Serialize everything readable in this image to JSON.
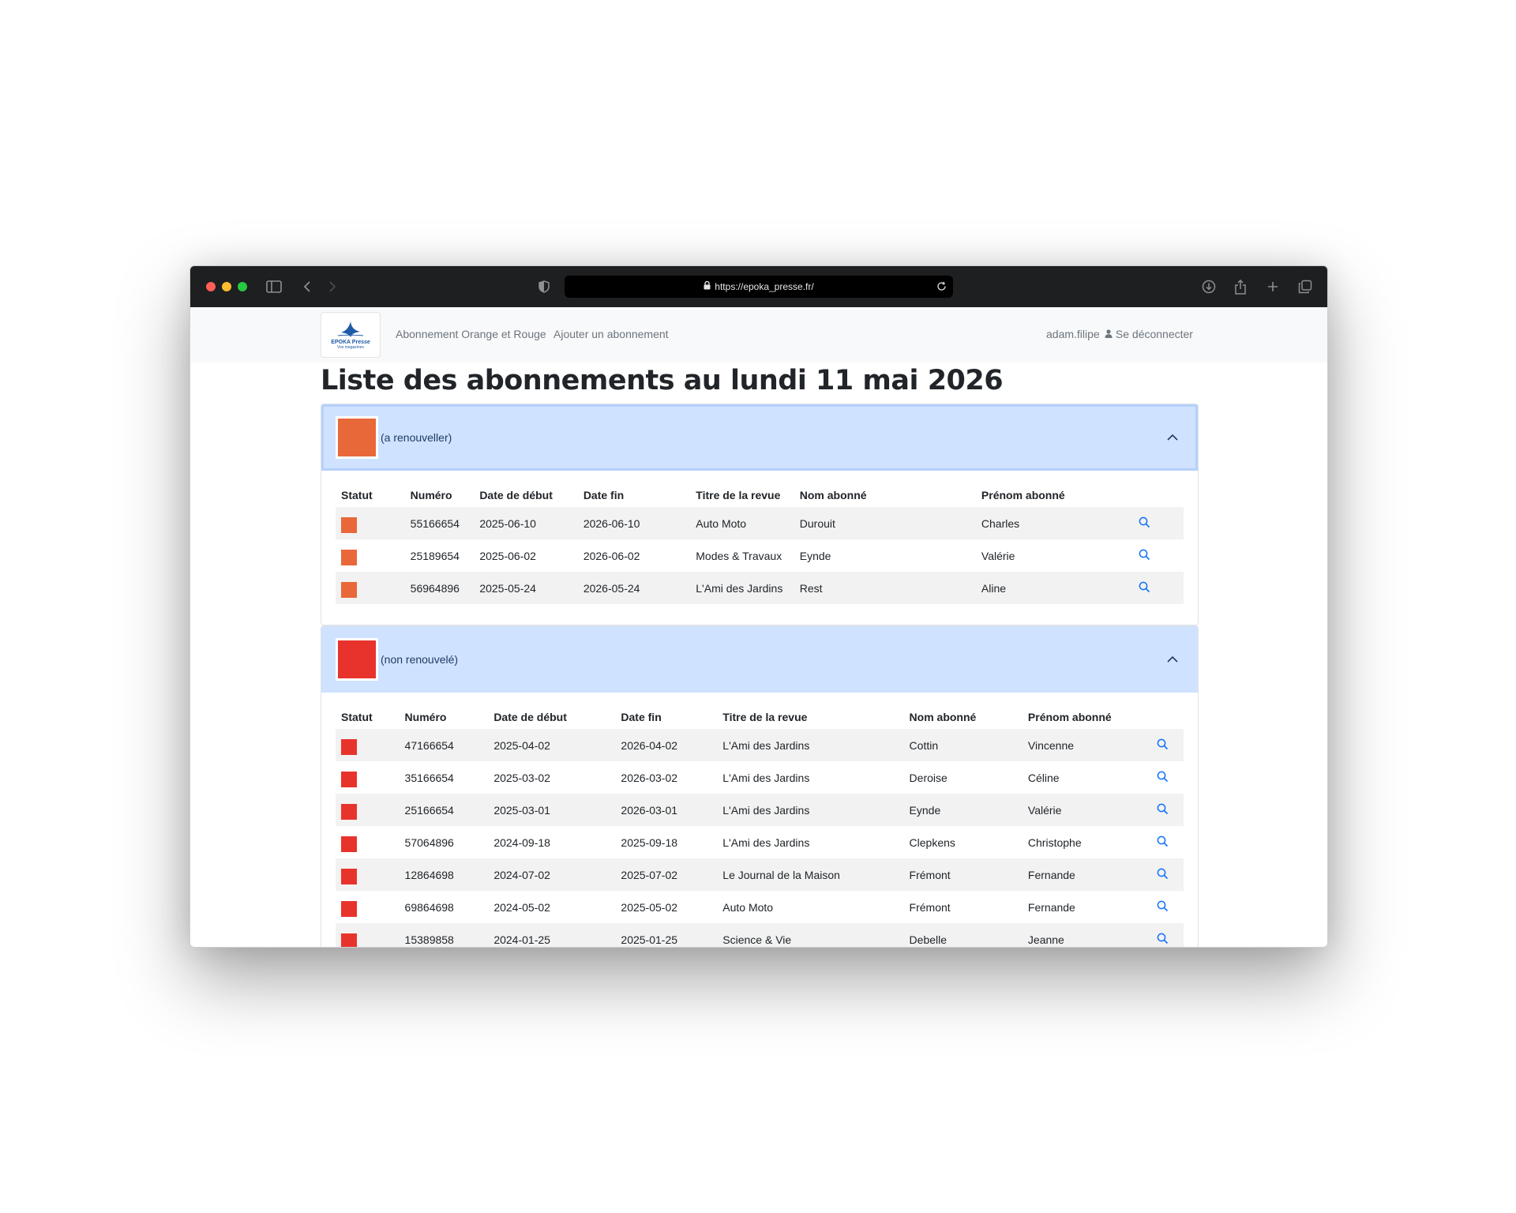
{
  "browser": {
    "url": "https://epoka_presse.fr/",
    "traffic_colors": [
      "#ff5f57",
      "#febc2e",
      "#28c840"
    ]
  },
  "navbar": {
    "logo_name": "EPOKA Presse",
    "logo_tagline": "Vos magazines",
    "link_1": "Abonnement Orange et Rouge",
    "link_2": "Ajouter un abonnement",
    "username": "adam.filipe",
    "logout": "Se déconnecter"
  },
  "page": {
    "title": "Liste des abonnements au lundi 11 mai 2026"
  },
  "columns": [
    "Statut",
    "Numéro",
    "Date de début",
    "Date fin",
    "Titre de la revue",
    "Nom abonné",
    "Prénom abonné"
  ],
  "sections": [
    {
      "label": "(a renouveller)",
      "color": "#e8683a",
      "rows": [
        {
          "numero": "55166654",
          "debut": "2025-06-10",
          "fin": "2026-06-10",
          "titre": "Auto Moto",
          "nom": "Durouit",
          "prenom": "Charles"
        },
        {
          "numero": "25189654",
          "debut": "2025-06-02",
          "fin": "2026-06-02",
          "titre": "Modes & Travaux",
          "nom": "Eynde",
          "prenom": "Valérie"
        },
        {
          "numero": "56964896",
          "debut": "2025-05-24",
          "fin": "2026-05-24",
          "titre": "L'Ami des Jardins",
          "nom": "Rest",
          "prenom": "Aline"
        }
      ]
    },
    {
      "label": "(non renouvelé)",
      "color": "#e8332d",
      "rows": [
        {
          "numero": "47166654",
          "debut": "2025-04-02",
          "fin": "2026-04-02",
          "titre": "L'Ami des Jardins",
          "nom": "Cottin",
          "prenom": "Vincenne"
        },
        {
          "numero": "35166654",
          "debut": "2025-03-02",
          "fin": "2026-03-02",
          "titre": "L'Ami des Jardins",
          "nom": "Deroise",
          "prenom": "Céline"
        },
        {
          "numero": "25166654",
          "debut": "2025-03-01",
          "fin": "2026-03-01",
          "titre": "L'Ami des Jardins",
          "nom": "Eynde",
          "prenom": "Valérie"
        },
        {
          "numero": "57064896",
          "debut": "2024-09-18",
          "fin": "2025-09-18",
          "titre": "L'Ami des Jardins",
          "nom": "Clepkens",
          "prenom": "Christophe"
        },
        {
          "numero": "12864698",
          "debut": "2024-07-02",
          "fin": "2025-07-02",
          "titre": "Le Journal de la Maison",
          "nom": "Frémont",
          "prenom": "Fernande"
        },
        {
          "numero": "69864698",
          "debut": "2024-05-02",
          "fin": "2025-05-02",
          "titre": "Auto Moto",
          "nom": "Frémont",
          "prenom": "Fernande"
        },
        {
          "numero": "15389858",
          "debut": "2024-01-25",
          "fin": "2025-01-25",
          "titre": "Science & Vie",
          "nom": "Debelle",
          "prenom": "Jeanne"
        }
      ]
    }
  ]
}
